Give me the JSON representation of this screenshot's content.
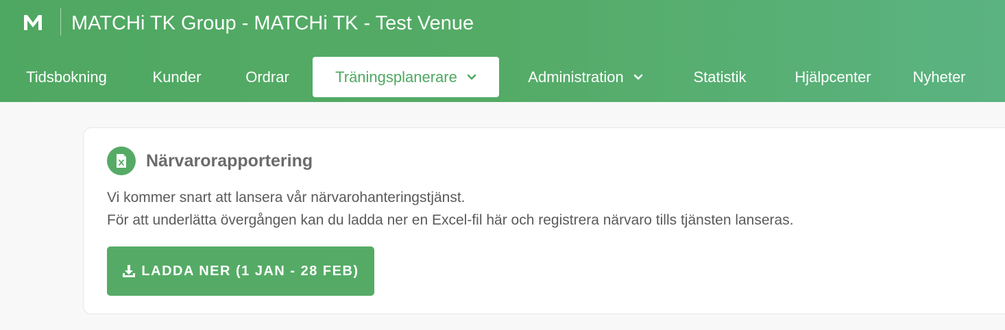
{
  "header": {
    "logo_letter": "M",
    "title": "MATCHi TK Group - MATCHi TK - Test Venue"
  },
  "nav": {
    "items": [
      {
        "label": "Tidsbokning"
      },
      {
        "label": "Kunder"
      },
      {
        "label": "Ordrar"
      },
      {
        "label": "Träningsplanerare",
        "active": true,
        "dropdown": true
      },
      {
        "label": "Administration",
        "dropdown": true
      },
      {
        "label": "Statistik"
      },
      {
        "label": "Hjälpcenter"
      },
      {
        "label": "Nyheter"
      }
    ]
  },
  "card": {
    "icon": "excel-file-icon",
    "title": "Närvarorapportering",
    "line1": "Vi kommer snart att lansera vår närvarohanteringstjänst.",
    "line2": "För att underlätta övergången kan du ladda ner en Excel-fil här och registrera närvaro tills tjänsten lanseras.",
    "button_label": "LADDA NER (1 JAN - 28 FEB)",
    "button_icon": "download-icon"
  },
  "colors": {
    "brand_green": "#55ab66",
    "header_gradient_end": "#5bb381",
    "active_tab_text": "#4fa862"
  }
}
